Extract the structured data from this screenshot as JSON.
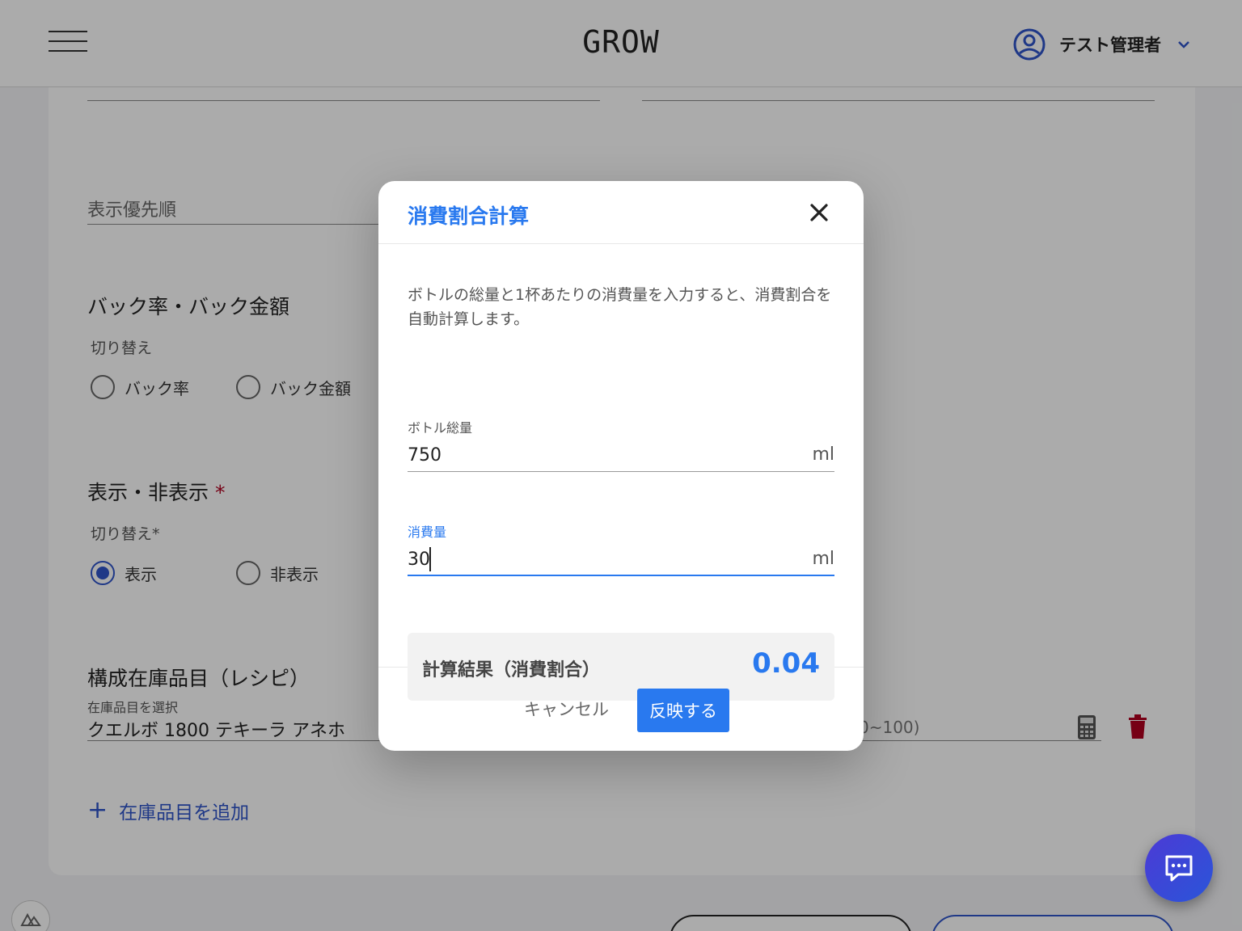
{
  "header": {
    "brand": "GROW",
    "user_name": "テスト管理者"
  },
  "form": {
    "priority_label": "表示優先順",
    "back_section_title": "バック率・バック金額",
    "back_toggle_label": "切り替え",
    "back_options": [
      "バック率",
      "バック金額"
    ],
    "visibility_section_title": "表示・非表示",
    "required_mark": "*",
    "visibility_toggle_label": "切り替え*",
    "visibility_options": [
      "表示",
      "非表示"
    ],
    "visibility_selected": "表示",
    "recipe_section_title": "構成在庫品目（レシピ）",
    "recipe_item_label": "在庫品目を選択",
    "recipe_item_value": "クエルボ 1800 テキーラ アネホ",
    "recipe_ratio_hint": "0~100)",
    "add_item_label": "在庫品目を追加"
  },
  "modal": {
    "title": "消費割合計算",
    "description": "ボトルの総量と1杯あたりの消費量を入力すると、消費割合を自動計算します。",
    "bottle_label": "ボトル総量",
    "bottle_value": "750",
    "bottle_unit": "ml",
    "consume_label": "消費量",
    "consume_value": "30",
    "consume_unit": "ml",
    "result_label": "計算結果（消費割合）",
    "result_value": "0.04",
    "cancel_label": "キャンセル",
    "apply_label": "反映する"
  },
  "colors": {
    "accent": "#2979ef",
    "radio_selected": "#2f54c9",
    "danger": "#b00020"
  }
}
